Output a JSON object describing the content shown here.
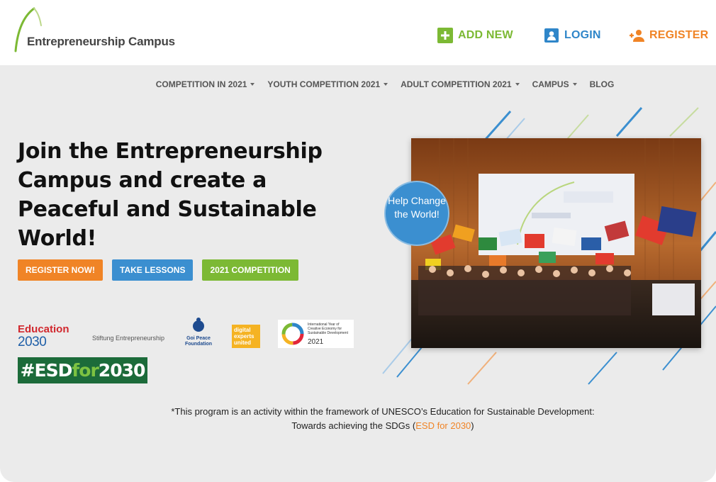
{
  "header": {
    "logo_text": "Entrepreneurship Campus",
    "add_new": "ADD NEW",
    "login": "LOGIN",
    "register": "REGISTER"
  },
  "nav": {
    "items": [
      {
        "label": "COMPETITION IN 2021",
        "dropdown": true
      },
      {
        "label": "YOUTH COMPETITION 2021",
        "dropdown": true
      },
      {
        "label": "ADULT COMPETITION 2021",
        "dropdown": true
      },
      {
        "label": "CAMPUS",
        "dropdown": true
      },
      {
        "label": "BLOG",
        "dropdown": false
      }
    ]
  },
  "hero": {
    "title": "Join the Entrepreneurship Campus and create a Peaceful and Sustainable World!",
    "buttons": {
      "register_now": "REGISTER NOW!",
      "take_lessons": "TAKE LESSONS",
      "competition": "2021 COMPETITION"
    },
    "help_bubble": "Help Change the World!"
  },
  "partners": {
    "education_line1": "Education",
    "education_line2": "2030",
    "stiftung": "Stiftung Entrepreneurship",
    "goi": "Goi Peace Foundation",
    "digital": "digital experts united",
    "year_text": "International Year of Creative Economy for Sustainable Development",
    "year_num": "2021",
    "esd_prefix": "#ESD",
    "esd_for": "for",
    "esd_suffix": "2030"
  },
  "note": {
    "line1": "*This program is an activity within the framework of UNESCO’s Education for Sustainable Development:",
    "line2_prefix": "Towards achieving the SDGs (",
    "line2_link": "ESD for 2030",
    "line2_suffix": ")"
  },
  "colors": {
    "green": "#7cb934",
    "blue": "#2f86c9",
    "orange": "#f08426",
    "background": "#ebebeb"
  }
}
